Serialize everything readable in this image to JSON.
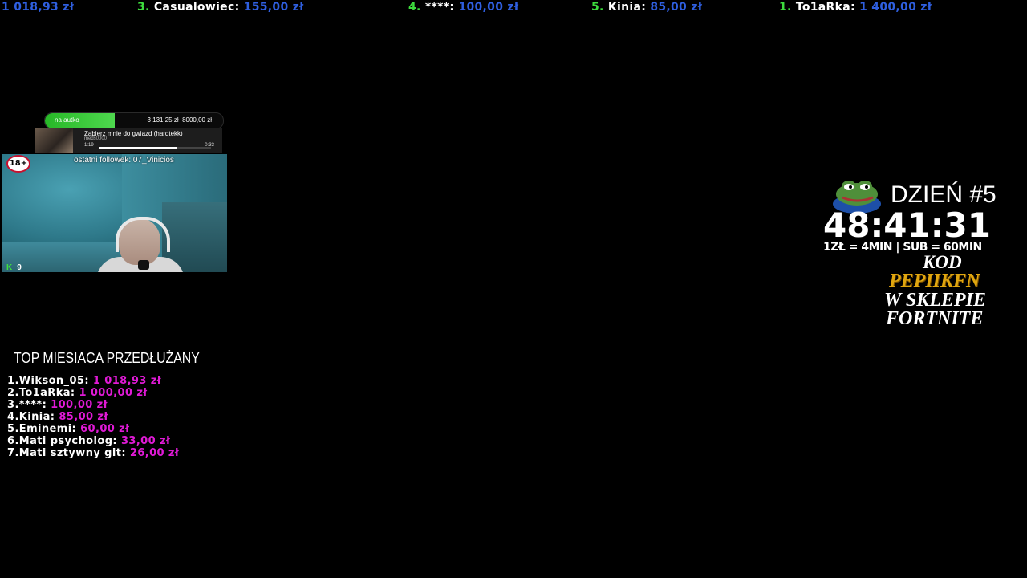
{
  "ticker": [
    {
      "rank": "",
      "name": "",
      "amount": "1 018,93 zł"
    },
    {
      "rank": "3.",
      "name": "Casualowiec:",
      "amount": "155,00 zł"
    },
    {
      "rank": "4.",
      "name": "****:",
      "amount": "100,00 zł"
    },
    {
      "rank": "5.",
      "name": "Kinia:",
      "amount": "85,00 zł"
    },
    {
      "rank": "1.",
      "name": "To1aRka:",
      "amount": "1 400,00 zł"
    }
  ],
  "goal": {
    "label": "na autko",
    "current": "3 131,25 zł",
    "target": "8000,00 zł",
    "progress": 0.39
  },
  "music": {
    "title": "Zabierz mnie do gwiazd (hardtekk)",
    "artist": "meds0000",
    "elapsed": "1:19",
    "remaining": "-0:33",
    "progress": 0.7
  },
  "stream": {
    "age_badge": "18+",
    "last_follower": "ostatni followek: 07_Vinicios",
    "viewers_icon": "K",
    "viewers": "9"
  },
  "subathon": {
    "day": "DZIEŃ #5",
    "timer": "48:41:31",
    "rate": "1ZŁ = 4MIN | SUB = 60MIN",
    "kod": "KOD",
    "code": "PEPIIKFN",
    "line3": "W SKLEPIE",
    "line4": "FORTNITE"
  },
  "top_month": {
    "title": "TOP MIESIACA PRZEDŁUŻANY",
    "entries": [
      {
        "rank": "1.",
        "name": "Wikson_05:",
        "amount": "1 018,93 zł"
      },
      {
        "rank": "2.",
        "name": "To1aRka:",
        "amount": "1 000,00 zł"
      },
      {
        "rank": "3.",
        "name": "****:",
        "amount": "100,00 zł"
      },
      {
        "rank": "4.",
        "name": "Kinia:",
        "amount": "85,00 zł"
      },
      {
        "rank": "5.",
        "name": "Eminemi:",
        "amount": "60,00 zł"
      },
      {
        "rank": "6.",
        "name": "Mati psycholog:",
        "amount": "33,00 zł"
      },
      {
        "rank": "7.",
        "name": "Mati sztywny git:",
        "amount": "26,00 zł"
      }
    ]
  },
  "colors": {
    "ticker_rank": "#3ddc3d",
    "ticker_amount": "#2f5fe0",
    "top_amount": "#e01ad6",
    "code": "#e0a60f",
    "goal_fill": "#27b827"
  }
}
